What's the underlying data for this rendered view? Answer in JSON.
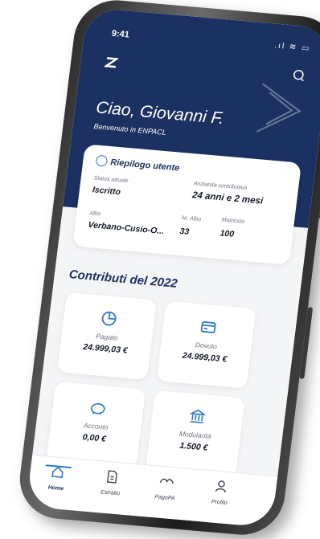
{
  "status_bar": {
    "time": "9:41",
    "icons": ".ıl ≋ ▭"
  },
  "header": {
    "greeting": "Ciao, Giovanni F.",
    "subtitle": "Benvenuto in ENPACL"
  },
  "summary_card": {
    "title": "Riepilogo utente",
    "status_label": "Status attuale",
    "status_value": "Iscritto",
    "anzianita_label": "Anzianità contributiva",
    "anzianita_value": "24 anni e 2 mesi",
    "albo_label": "Albo",
    "albo_value": "Verbano-Cusio-O...",
    "nr_albo_label": "Nr. Albo",
    "nr_albo_value": "33",
    "matricola_label": "Matricola",
    "matricola_value": "100"
  },
  "contributi": {
    "title": "Contributi del 2022",
    "tiles": [
      {
        "label": "Pagato",
        "value": "24.999,03 €",
        "icon": "pie-chart-icon"
      },
      {
        "label": "Dovuto",
        "value": "24.999,03 €",
        "icon": "credit-card-icon"
      },
      {
        "label": "Acconto",
        "value": "0,00 €",
        "icon": "piggy-bank-icon"
      },
      {
        "label": "Modularità",
        "value": "1.500 €",
        "icon": "bank-icon"
      }
    ]
  },
  "tabbar": {
    "items": [
      {
        "label": "Home",
        "icon": "home-icon",
        "active": true
      },
      {
        "label": "Estratto",
        "icon": "document-icon",
        "active": false
      },
      {
        "label": "PagoPA",
        "icon": "pagopa-icon",
        "active": false
      },
      {
        "label": "Profilo",
        "icon": "user-icon",
        "active": false
      }
    ]
  },
  "colors": {
    "primary": "#1b3161",
    "accent": "#2a7bd0",
    "background": "#f4f5f7"
  }
}
